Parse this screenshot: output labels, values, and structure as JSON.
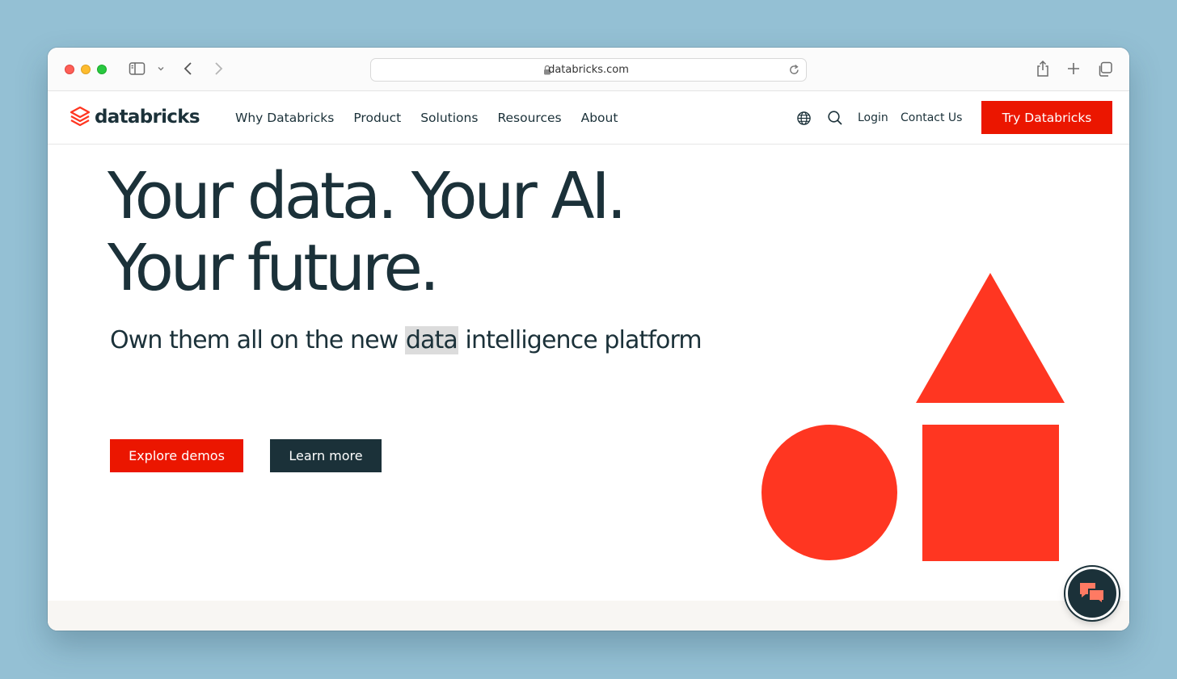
{
  "browser": {
    "url": "databricks.com",
    "icons": [
      "sidebar-icon",
      "chevron-down-icon",
      "back-icon",
      "forward-icon",
      "lock-icon",
      "reload-icon",
      "share-icon",
      "new-tab-icon",
      "tabs-overview-icon"
    ]
  },
  "nav": {
    "logo_text": "databricks",
    "links": [
      "Why Databricks",
      "Product",
      "Solutions",
      "Resources",
      "About"
    ],
    "login": "Login",
    "contact": "Contact Us",
    "cta": "Try Databricks"
  },
  "hero": {
    "headline_line1": "Your data. Your AI.",
    "headline_line2": "Your future.",
    "subline_before": "Own them all on the new ",
    "subline_highlight": "data",
    "subline_after": " intelligence platform",
    "primary_button": "Explore demos",
    "secondary_button": "Learn more"
  },
  "colors": {
    "brand_red": "#eb1600",
    "shape_red": "#ff3621",
    "navy": "#1b3139",
    "chat_accent": "#ff7a63"
  }
}
